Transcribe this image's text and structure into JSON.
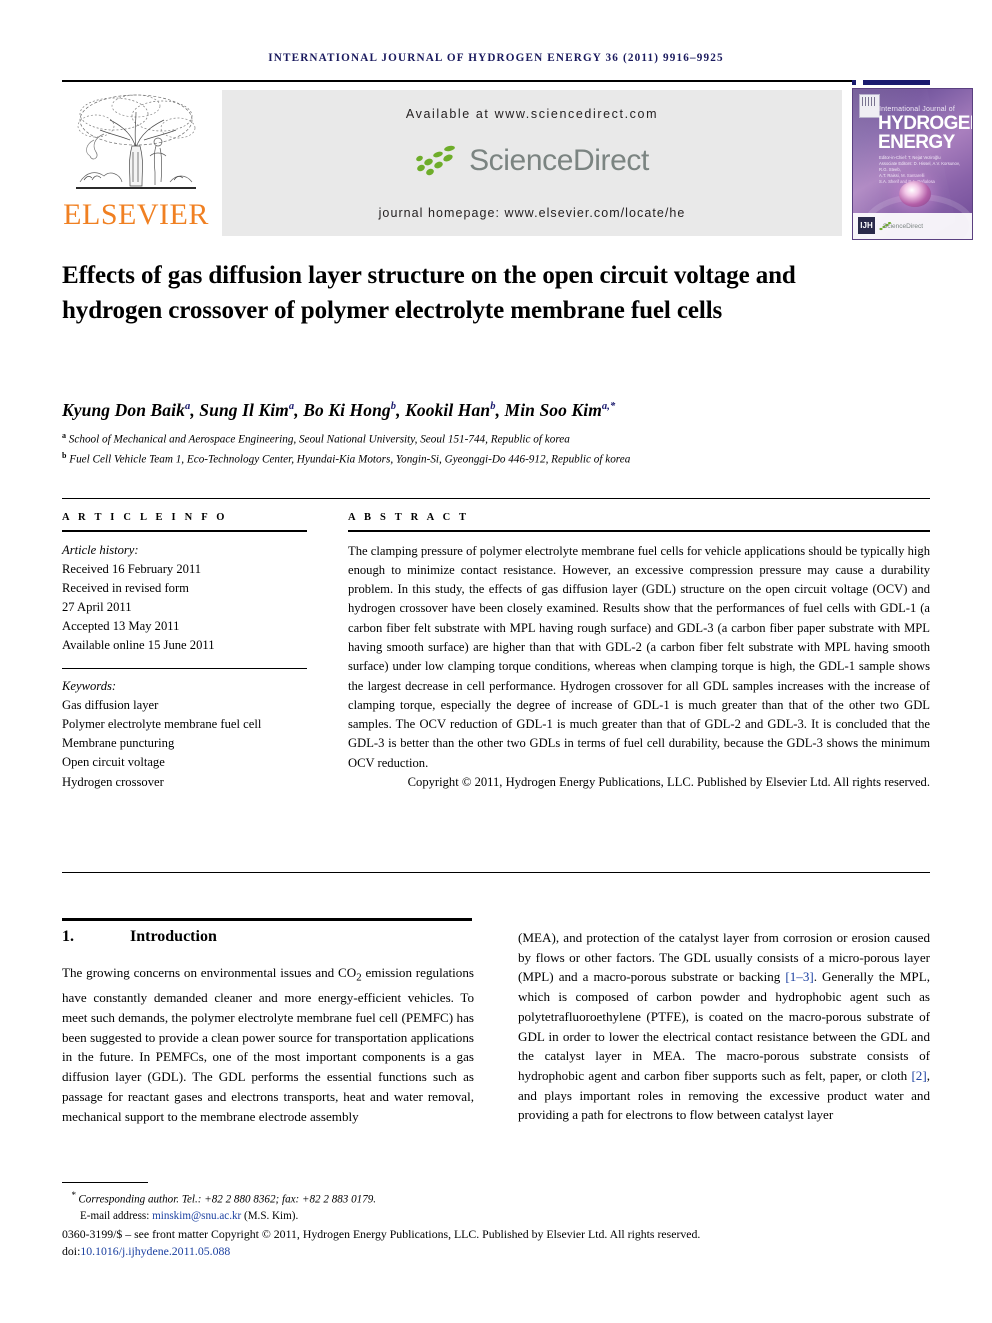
{
  "running_head": {
    "text": "INTERNATIONAL JOURNAL OF HYDROGEN ENERGY 36 (2011) 9916–9925"
  },
  "masthead": {
    "publisher_logo_label": "ELSEVIER",
    "available_at": "Available at www.sciencedirect.com",
    "sciencedirect_wordmark": "ScienceDirect",
    "journal_homepage": "journal homepage: www.elsevier.com/locate/he",
    "cover": {
      "line_small": "International Journal of",
      "line_big_1": "HYDROGEN",
      "line_big_2": "ENERGY",
      "meta_1": "Editor-in-Chief:  T. Nejat Veziroğlu",
      "meta_2": "Associate Editors:  D. Hissel, A.V. Korsunov, R.G. Steeb,",
      "meta_3": "A.T. Raissi, M. Santarelli",
      "meta_4": "S.A. Sherif and B.A. Peñalosa",
      "badge": "IJH",
      "sciencedirect": "ScienceDirect"
    }
  },
  "article": {
    "title": "Effects of gas diffusion layer structure on the open circuit voltage and hydrogen crossover of polymer electrolyte membrane fuel cells",
    "authors_html": "Kyung Don Baik<sup>a</sup>, Sung Il Kim<sup>a</sup>, Bo Ki Hong<sup>b</sup>, Kookil Han<sup>b</sup>, Min Soo Kim<sup>a,*</sup>",
    "affiliations": [
      "School of Mechanical and Aerospace Engineering, Seoul National University, Seoul 151-744, Republic of korea",
      "Fuel Cell Vehicle Team 1, Eco-Technology Center, Hyundai-Kia Motors, Yongin-Si, Gyeonggi-Do 446-912, Republic of korea"
    ],
    "affiliation_marks": [
      "a",
      "b"
    ]
  },
  "article_info": {
    "heading": "A R T I C L E    I N F O",
    "history_label": "Article history:",
    "history": [
      "Received 16 February 2011",
      "Received in revised form",
      "27 April 2011",
      "Accepted 13 May 2011",
      "Available online 15 June 2011"
    ],
    "keywords_label": "Keywords:",
    "keywords": [
      "Gas diffusion layer",
      "Polymer electrolyte membrane fuel cell",
      "Membrane puncturing",
      "Open circuit voltage",
      "Hydrogen crossover"
    ]
  },
  "abstract": {
    "heading": "A B S T R A C T",
    "body": "The clamping pressure of polymer electrolyte membrane fuel cells for vehicle applications should be typically high enough to minimize contact resistance. However, an excessive compression pressure may cause a durability problem. In this study, the effects of gas diffusion layer (GDL) structure on the open circuit voltage (OCV) and hydrogen crossover have been closely examined. Results show that the performances of fuel cells with GDL-1 (a carbon fiber felt substrate with MPL having rough surface) and GDL-3 (a carbon fiber paper substrate with MPL having smooth surface) are higher than that with GDL-2 (a carbon fiber felt substrate with MPL having smooth surface) under low clamping torque conditions, whereas when clamping torque is high, the GDL-1 sample shows the largest decrease in cell performance. Hydrogen crossover for all GDL samples increases with the increase of clamping torque, especially the degree of increase of GDL-1 is much greater than that of the other two GDL samples. The OCV reduction of GDL-1 is much greater than that of GDL-2 and GDL-3. It is concluded that the GDL-3 is better than the other two GDLs in terms of fuel cell durability, because the GDL-3 shows the minimum OCV reduction.",
    "copyright": "Copyright © 2011, Hydrogen Energy Publications, LLC. Published by Elsevier Ltd. All rights reserved."
  },
  "section": {
    "number": "1.",
    "title": "Introduction",
    "left_column": "The growing concerns on environmental issues and CO<sub>2</sub> emission regulations have constantly demanded cleaner and more energy-efficient vehicles. To meet such demands, the polymer electrolyte membrane fuel cell (PEMFC) has been suggested to provide a clean power source for transportation applications in the future. In PEMFCs, one of the most important components is a gas diffusion layer (GDL). The GDL performs the essential functions such as passage for reactant gases and electrons transports, heat and water removal, mechanical support to the membrane electrode assembly",
    "right_column": "(MEA), and protection of the catalyst layer from corrosion or erosion caused by flows or other factors. The GDL usually consists of a micro-porous layer (MPL) and a macro-porous substrate or backing <span class=\"cite\">[1–3]</span>. Generally the MPL, which is composed of carbon powder and hydrophobic agent such as polytetrafluoroethylene (PTFE), is coated on the macro-porous substrate of GDL in order to lower the electrical contact resistance between the GDL and the catalyst layer in MEA. The macro-porous substrate consists of hydrophobic agent and carbon fiber supports such as felt, paper, or cloth <span class=\"cite\">[2]</span>, and plays important roles in removing the excessive product water and providing a path for electrons to flow between catalyst layer"
  },
  "footer": {
    "corresponding_author": "Corresponding author. Tel.: +82 2 880 8362; fax: +82 2 883 0179.",
    "email_label": "E-mail address:",
    "email": "minskim@snu.ac.kr",
    "email_suffix": "(M.S. Kim).",
    "issn_line": "0360-3199/$ – see front matter Copyright © 2011, Hydrogen Energy Publications, LLC. Published by Elsevier Ltd. All rights reserved.",
    "doi_label": "doi:",
    "doi": "10.1016/j.ijhydene.2011.05.088"
  },
  "colors": {
    "journal_blue": "#1a1a5e",
    "link_blue": "#1a3fa0",
    "elsevier_orange": "#f08022",
    "sciencedirect_green": "#6ead2a",
    "banner_gray": "#e9e9e9"
  }
}
